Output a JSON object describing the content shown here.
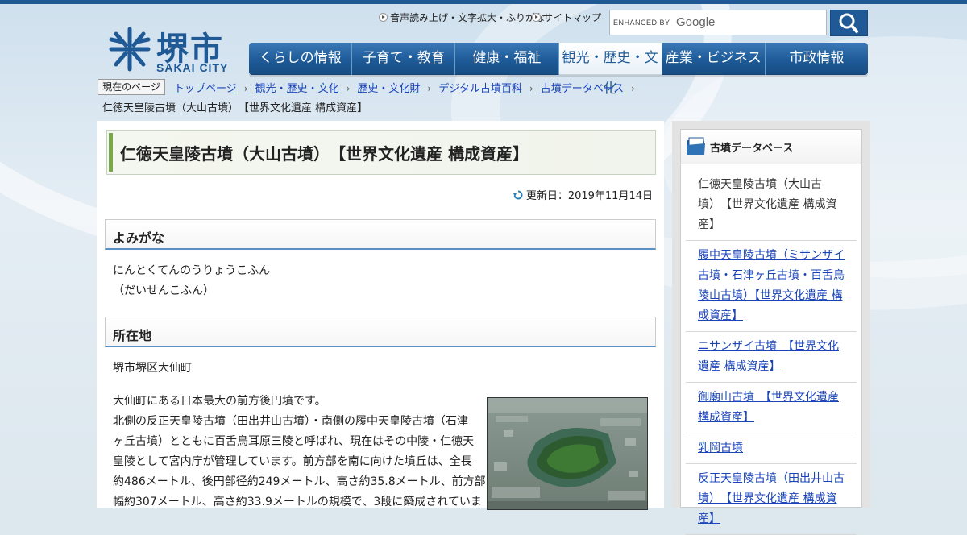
{
  "header": {
    "logo_kanji": "堺市",
    "logo_sub": "SAKAI CITY",
    "util_links": [
      "音声読み上げ・文字拡大・ふりがな",
      "サイトマップ"
    ],
    "search": {
      "enhanced_label": "ENHANCED BY",
      "brand": "Google",
      "button_icon": "search-icon"
    },
    "nav": [
      {
        "label": "くらしの情報",
        "active": false
      },
      {
        "label": "子育て・教育",
        "active": false
      },
      {
        "label": "健康・福祉",
        "active": false
      },
      {
        "label": "観光・歴史・文化",
        "active": true
      },
      {
        "label": "産業・ビジネス",
        "active": false
      },
      {
        "label": "市政情報",
        "active": false
      }
    ]
  },
  "breadcrumb": {
    "label": "現在のページ",
    "items": [
      "トップページ",
      "観光・歴史・文化",
      "歴史・文化財",
      "デジタル古墳百科",
      "古墳データベース"
    ],
    "current": "仁徳天皇陵古墳（大山古墳）　【世界文化遺産 構成資産】"
  },
  "main": {
    "title": "仁徳天皇陵古墳（大山古墳）　【世界文化遺産 構成資産】",
    "updated": "更新日：2019年11月14日",
    "sections": [
      {
        "heading": "よみがな",
        "lines": [
          "にんとくてんのうりょうこふん",
          "（だいせんこふん）"
        ]
      },
      {
        "heading": "所在地",
        "lines": [
          "堺市堺区大仙町"
        ]
      }
    ],
    "body_lines": [
      "大仙町にある日本最大の前方後円墳です。",
      "北側の反正天皇陵古墳（田出井山古墳）・南側の履中天皇陵古墳（石津",
      "ヶ丘古墳）とともに百舌鳥耳原三陵と呼ばれ、現在はその中陵・仁徳天",
      "皇陵として宮内庁が管理しています。前方部を南に向けた墳丘は、全長",
      "約486メートル、後円部径約249メートル、高さ約35.8メートル、前方部",
      "幅約307メートル、高さ約33.9メートルの規模で、3段に築成されていま"
    ]
  },
  "sidebar": {
    "title": "古墳データベース",
    "items": [
      {
        "lines": [
          "仁徳天皇陵古墳（大山古",
          "墳）　【世界文化遺産 構成資",
          "産】"
        ],
        "link": false
      },
      {
        "lines": [
          "履中天皇陵古墳（ミサンザイ",
          "古墳・石津ヶ丘古墳・百舌鳥",
          "陵山古墳）【世界文化遺産 構",
          "成資産】"
        ],
        "link": true
      },
      {
        "lines": [
          "ニサンザイ古墳　【世界文化",
          "遺産 構成資産】"
        ],
        "link": true
      },
      {
        "lines": [
          "御廟山古墳　【世界文化遺産",
          "構成資産】"
        ],
        "link": true
      },
      {
        "lines": [
          "乳岡古墳"
        ],
        "link": true
      },
      {
        "lines": [
          "反正天皇陵古墳（田出井山古",
          "墳）　【世界文化遺産 構成資",
          "産】"
        ],
        "link": true
      }
    ]
  },
  "colors": {
    "brand": "#1f5a96",
    "link": "#1a44b8",
    "accent_green": "#79a84a"
  }
}
